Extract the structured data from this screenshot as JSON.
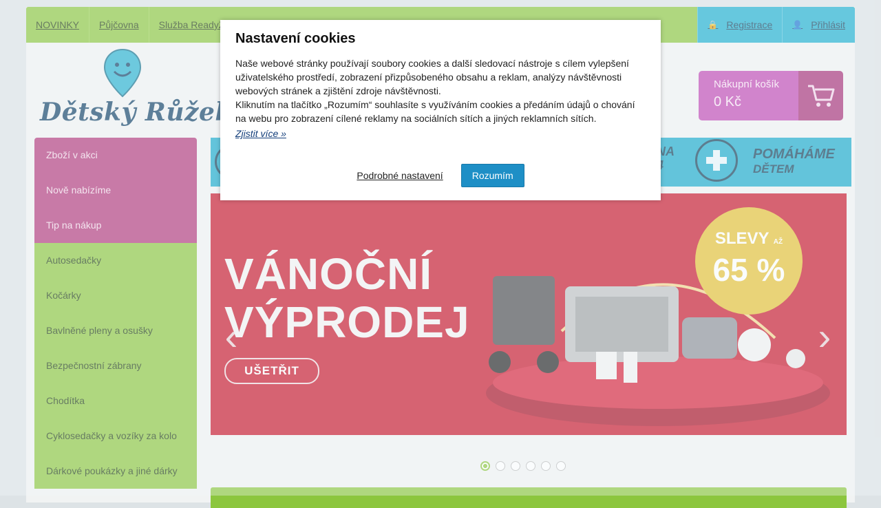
{
  "topnav": {
    "links": [
      "NOVINKY",
      "Půjčovna",
      "Služba ReadyZ"
    ],
    "register": "Registrace",
    "login": "Přihlásit"
  },
  "logo": {
    "text": "Dětský Růžek"
  },
  "cart": {
    "title": "Nákupní košík",
    "total": "0 Kč"
  },
  "sidebar": {
    "items": [
      {
        "label": "Zboží v akci"
      },
      {
        "label": "Nově nabízíme"
      },
      {
        "label": "Tip na nákup"
      },
      {
        "label": "Autosedačky"
      },
      {
        "label": "Kočárky"
      },
      {
        "label": "Bavlněné pleny a osušky"
      },
      {
        "label": "Bezpečnostní zábrany"
      },
      {
        "label": "Chodítka"
      },
      {
        "label": "Cyklosedačky a vozíky za kolo"
      },
      {
        "label": "Dárkové poukázky a jiné dárky"
      }
    ]
  },
  "strip": {
    "partial_text_1": "NA",
    "partial_text_2": "4",
    "help_line1": "POMÁHÁME",
    "help_line2": "DĚTEM"
  },
  "banner": {
    "title_line1": "VÁNOČNÍ",
    "title_line2": "VÝPRODEJ",
    "button": "UŠETŘIT",
    "disc_line1": "SLEVY",
    "disc_small": "AŽ",
    "disc_line2": "65 %"
  },
  "carousel": {
    "slide_count": 6,
    "active": 1
  },
  "cookies": {
    "title": "Nastavení cookies",
    "text1": "Naše webové stránky používají soubory cookies a další sledovací nástroje s cílem vylepšení uživatelského prostředí, zobrazení přizpůsobeného obsahu a reklam, analýzy návštěvnosti webových stránek a zjištění zdroje návštěvnosti.",
    "text2": "Kliknutím na tlačítko „Rozumím“ souhlasíte s využíváním cookies a předáním údajů o chování na webu pro zobrazení cílené reklamy na sociálních sítích a jiných reklamních sítích.",
    "more": "Zjistit více »",
    "settings": "Podrobné nastavení",
    "accept": "Rozumím"
  }
}
